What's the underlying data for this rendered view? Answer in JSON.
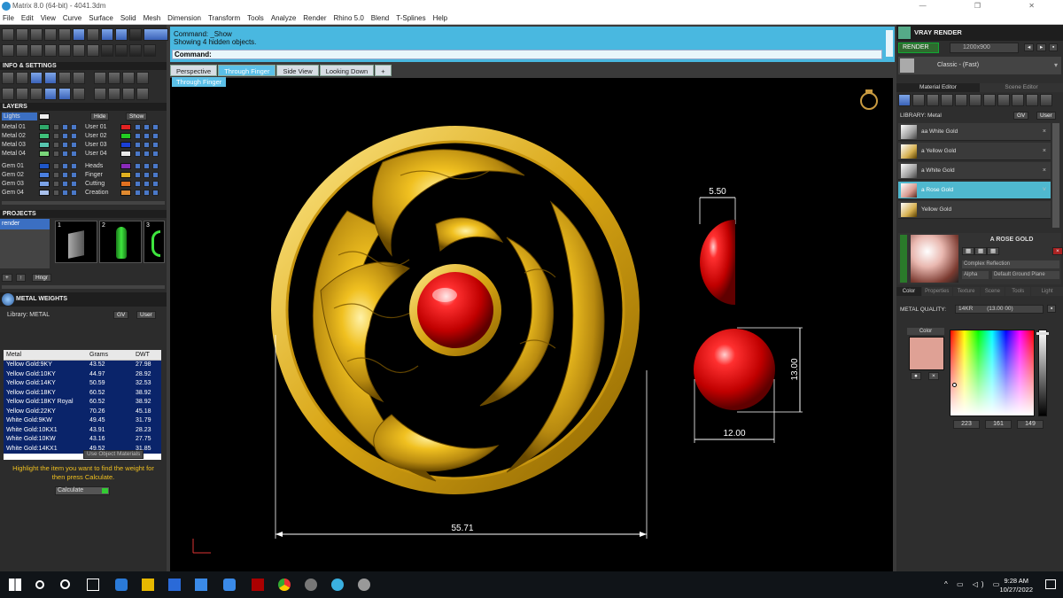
{
  "window": {
    "title": "Matrix 8.0 (64-bit) - 4041.3dm"
  },
  "menu": [
    "File",
    "Edit",
    "View",
    "Curve",
    "Surface",
    "Solid",
    "Mesh",
    "Dimension",
    "Transform",
    "Tools",
    "Analyze",
    "Render",
    "Rhino 5.0",
    "Blend",
    "T-Splines",
    "Help"
  ],
  "left": {
    "info_title": "INFO & SETTINGS",
    "layers_title": "LAYERS",
    "lights_label": "Lights",
    "hide_label": "Hide",
    "show_label": "Show",
    "metal_layers": [
      {
        "name": "Metal 01",
        "color": "#2fa86a"
      },
      {
        "name": "Metal 02",
        "color": "#3fc07a"
      },
      {
        "name": "Metal 03",
        "color": "#57c6b0"
      },
      {
        "name": "Metal 04",
        "color": "#7ad67a"
      }
    ],
    "user_layers": [
      {
        "name": "User 01",
        "color": "#e22222"
      },
      {
        "name": "User 02",
        "color": "#22cc22"
      },
      {
        "name": "User 03",
        "color": "#1a3fd6"
      },
      {
        "name": "User 04",
        "color": "#e8e8e8"
      }
    ],
    "gem_layers": [
      {
        "name": "Gem 01",
        "color": "#1e56c8"
      },
      {
        "name": "Gem 02",
        "color": "#4a7fe0"
      },
      {
        "name": "Gem 03",
        "color": "#7aa2e6"
      },
      {
        "name": "Gem 04",
        "color": "#a8c0ec"
      }
    ],
    "other_layers": [
      {
        "name": "Heads",
        "color": "#8a2ab8"
      },
      {
        "name": "Finger",
        "color": "#e0b020"
      },
      {
        "name": "Cutting",
        "color": "#e07020"
      },
      {
        "name": "Creation",
        "color": "#e08a30"
      }
    ],
    "projects_title": "PROJECTS",
    "project_name": "render",
    "project_nums": [
      "1",
      "2",
      "3"
    ],
    "hinge_label": "Hngr",
    "metal_weights_title": "METAL WEIGHTS",
    "library_label": "Library: METAL",
    "table_headers": [
      "Metal",
      "Grams",
      "DWT"
    ],
    "table_rows": [
      [
        "Yellow Gold:9KY",
        "43.52",
        "27.98"
      ],
      [
        "Yellow Gold:10KY",
        "44.97",
        "28.92"
      ],
      [
        "Yellow Gold:14KY",
        "50.59",
        "32.53"
      ],
      [
        "Yellow Gold:18KY",
        "60.52",
        "38.92"
      ],
      [
        "Yellow Gold:18KY Royal",
        "60.52",
        "38.92"
      ],
      [
        "Yellow Gold:22KY",
        "70.26",
        "45.18"
      ],
      [
        "White Gold:9KW",
        "49.45",
        "31.79"
      ],
      [
        "White Gold:10KX1",
        "43.91",
        "28.23"
      ],
      [
        "White Gold:10KW",
        "43.16",
        "27.75"
      ],
      [
        "White Gold:14KX1",
        "49.52",
        "31.85"
      ]
    ],
    "use_object_materials": "Use Object Materials",
    "help_text": "Highlight the item you want to find the weight for then press Calculate.",
    "calculate_label": "Calculate"
  },
  "command": {
    "line1": "Command: _Show",
    "line2": "Showing 4 hidden objects.",
    "prompt": "Command:"
  },
  "viewport_tabs": [
    "Perspective",
    "Through Finger",
    "Side View",
    "Looking Down",
    "+"
  ],
  "active_view": "Through Finger",
  "dimensions": {
    "width_total": "55.71",
    "gem_depth": "5.50",
    "gem_height": "13.00",
    "gem_width": "12.00"
  },
  "right": {
    "vray_title": "VRAY RENDER",
    "render_label": "RENDER",
    "resolution": "1200x900",
    "preset": "Classic - (Fast)",
    "tab_material": "Material Editor",
    "tab_scene": "Scene Editor",
    "library_label": "LIBRARY: Metal",
    "materials": [
      "aa White Gold",
      "a Yellow Gold",
      "a White Gold",
      "a Rose Gold",
      "Yellow Gold"
    ],
    "selected_material": "A ROSE GOLD",
    "reflection": "Complex Reflection",
    "alpha_label": "Alpha",
    "ground_plane": "Default Ground Plane",
    "subtabs": [
      "Color",
      "Properties",
      "Texture",
      "Scene",
      "Tools",
      "Light"
    ],
    "metal_quality_label": "METAL QUALITY:",
    "metal_quality_value": "14KR",
    "metal_quality_extra": "(13.00 00)",
    "color_label": "Color",
    "rgb": [
      "223",
      "161",
      "149"
    ],
    "swatch_color": "#dfa195"
  },
  "taskbar": {
    "time": "9:28 AM",
    "date": "10/27/2022"
  }
}
